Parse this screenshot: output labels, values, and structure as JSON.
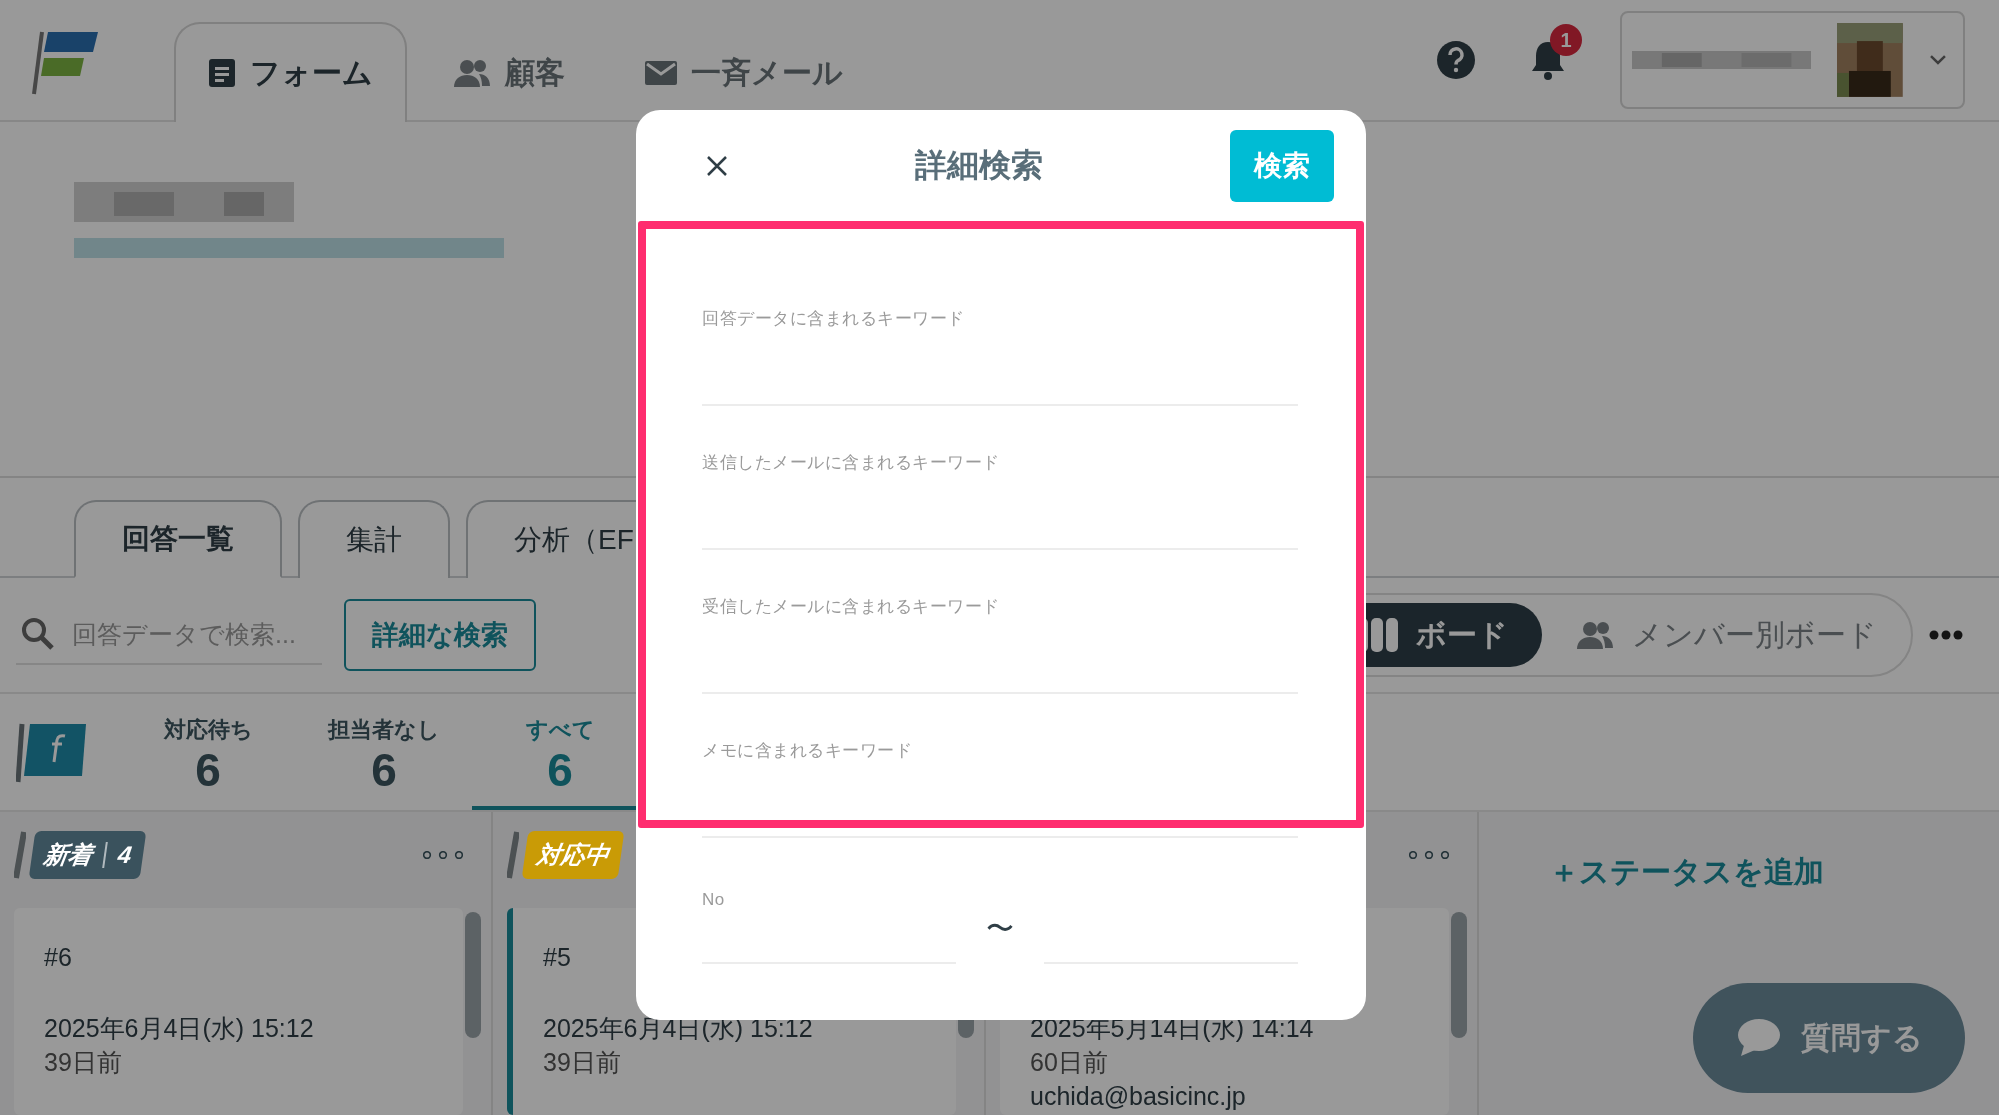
{
  "header": {
    "nav_tabs": [
      {
        "label": "フォーム",
        "selected": true
      },
      {
        "label": "顧客",
        "selected": false
      },
      {
        "label": "一斉メール",
        "selected": false
      }
    ],
    "notification_count": "1"
  },
  "form_tabs": [
    {
      "label": "回答一覧",
      "selected": true
    },
    {
      "label": "集計",
      "selected": false
    },
    {
      "label": "分析（EF",
      "selected": false
    }
  ],
  "toolbar": {
    "search_placeholder": "回答データで検索...",
    "advanced_button": "詳細な検索",
    "views": [
      {
        "label": "ボード",
        "selected": true
      },
      {
        "label": "メンバー別ボード",
        "selected": false
      }
    ]
  },
  "filters": [
    {
      "label": "対応待ち",
      "count": "6",
      "selected": false
    },
    {
      "label": "担当者なし",
      "count": "6",
      "selected": false
    },
    {
      "label": "すべて",
      "count": "6",
      "selected": true
    }
  ],
  "columns": [
    {
      "name": "新着",
      "count": "4",
      "color": "#3a525d",
      "cards": [
        {
          "number": "#6",
          "date": "2025年6月4日(水) 15:12",
          "ago": "39日前",
          "accent": false
        }
      ]
    },
    {
      "name": "対応中",
      "color": "#c99b06",
      "cards": [
        {
          "number": "#5",
          "date": "2025年6月4日(水) 15:12",
          "ago": "39日前",
          "accent": true
        }
      ]
    },
    {
      "cards": [
        {
          "date": "2025年5月14日(水) 14:14",
          "ago": "60日前",
          "email": "uchida@basicinc.jp",
          "accent": false
        }
      ]
    }
  ],
  "add_status": "＋ステータスを追加",
  "chat_button": "質問する",
  "dialog": {
    "title": "詳細検索",
    "search_button": "検索",
    "highlight": true,
    "keyword_fields": [
      {
        "label": "回答データに含まれるキーワード"
      },
      {
        "label": "送信したメールに含まれるキーワード"
      },
      {
        "label": "受信したメールに含まれるキーワード"
      },
      {
        "label": "メモに含まれるキーワード"
      }
    ],
    "number_range": {
      "label": "No",
      "separator": "〜"
    }
  }
}
